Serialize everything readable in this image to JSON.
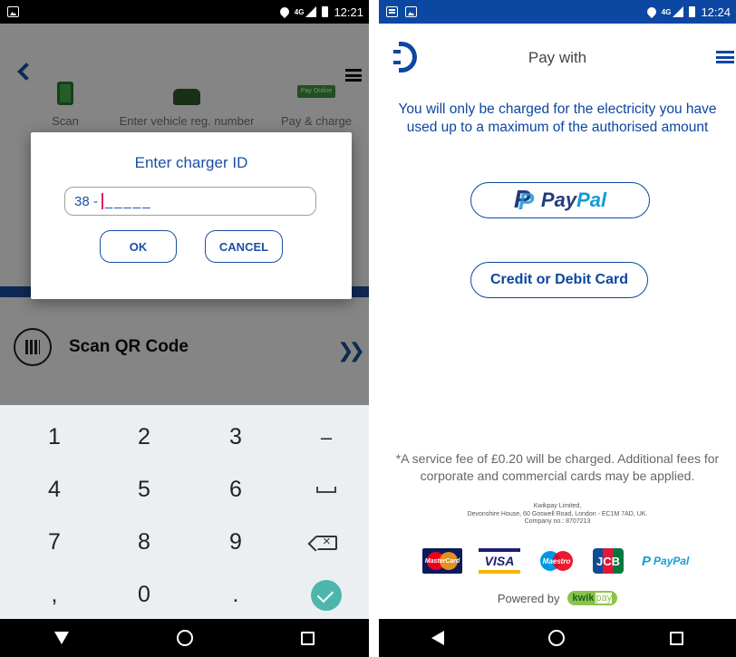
{
  "left_screen": {
    "status": {
      "network": "4G",
      "time": "12:21"
    },
    "features": [
      {
        "label": "Scan",
        "icon": "scan-phone-icon"
      },
      {
        "label": "Enter vehicle reg. number",
        "icon": "car-icon"
      },
      {
        "label": "Pay & charge",
        "icon": "pay-online-icon",
        "badge": "Pay Online"
      }
    ],
    "qr": {
      "label": "Scan QR Code"
    },
    "dialog": {
      "title": "Enter charger ID",
      "prefix": "38 -",
      "mask": "_____",
      "ok": "OK",
      "cancel": "CANCEL"
    },
    "keypad": {
      "rows": [
        [
          "1",
          "2",
          "3",
          "–"
        ],
        [
          "4",
          "5",
          "6",
          "space"
        ],
        [
          "7",
          "8",
          "9",
          "backspace"
        ],
        [
          ",",
          "0",
          ".",
          "done"
        ]
      ]
    }
  },
  "right_screen": {
    "status": {
      "network": "4G",
      "time": "12:24"
    },
    "header": {
      "title": "Pay with"
    },
    "notice": "You will only be charged for the electricity you have used up to a maximum of the authorised amount",
    "paypal_button": {
      "word_a": "Pay",
      "word_b": "Pal"
    },
    "card_button": "Credit or Debit Card",
    "fee_note": "*A service fee of £0.20 will be charged. Additional fees for corporate and commercial cards may be applied.",
    "company": {
      "line1": "Kwikpay Limited,",
      "line2": "Devonshire House, 60 Goswell Road, London - EC1M 7AD, UK.",
      "line3": "Company no.: 8707213"
    },
    "card_logos": {
      "mastercard": "MasterCard",
      "visa": "VISA",
      "maestro": "Maestro",
      "jcb": "JCB",
      "paypal": "PayPal"
    },
    "powered_by": {
      "label": "Powered by",
      "brand_a": "kwik",
      "brand_b": "pay"
    }
  },
  "colors": {
    "brand_blue": "#0c47a1",
    "dialog_blue": "#1c4fa3",
    "keyboard_bg": "#eceff1",
    "done_key": "#4db6ac"
  }
}
